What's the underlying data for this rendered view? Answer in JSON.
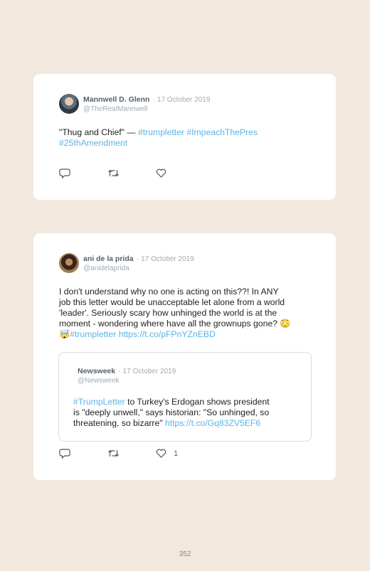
{
  "tweets": [
    {
      "name": "Mannwell D. Glenn",
      "date": "· 17 October 2019",
      "handle": "@TheRealMannwell",
      "lines": [
        [
          {
            "t": "\"Thug and Chief\" — ",
            "link": false
          },
          {
            "t": "#trumpletter #ImpeachThePres",
            "link": true
          }
        ],
        [
          {
            "t": "#25thAmendment",
            "link": true
          }
        ]
      ],
      "like_count": ""
    },
    {
      "name": "ani de la prida",
      "date": "· 17 October 2019",
      "handle": "@anidelaprida",
      "lines": [
        [
          {
            "t": "I don't understand why no one is acting on this??! In ANY",
            "link": false
          }
        ],
        [
          {
            "t": "job this letter would be unacceptable let alone from a world",
            "link": false
          }
        ],
        [
          {
            "t": "'leader'. Seriously scary how unhinged the world is at the",
            "link": false
          }
        ],
        [
          {
            "t": "moment - wondering where have all the grownups gone? 😳",
            "link": false
          }
        ],
        [
          {
            "t": "🤯",
            "link": false
          },
          {
            "t": "#trumpletter https://t.co/pFPnYZnEBD",
            "link": true
          }
        ]
      ],
      "like_count": "1",
      "quoted": {
        "name": "Newsweek",
        "date": "· 17 October 2019",
        "handle": "@Newsweek",
        "lines": [
          [
            {
              "t": "#TrumpLetter",
              "link": true
            },
            {
              "t": " to Turkey's Erdogan shows president",
              "link": false
            }
          ],
          [
            {
              "t": "is \"deeply unwell,\" says historian: \"So unhinged, so",
              "link": false
            }
          ],
          [
            {
              "t": "threatening, so bizarre\" ",
              "link": false
            },
            {
              "t": "https://t.co/Gq83ZV5EF6",
              "link": true
            }
          ]
        ]
      }
    }
  ],
  "page_number": "352",
  "colors": {
    "background": "#f3e8de",
    "card": "#ffffff",
    "link": "#5bb3e6",
    "muted": "#a4aab0"
  },
  "icons": [
    "reply-icon",
    "retweet-icon",
    "like-icon"
  ]
}
